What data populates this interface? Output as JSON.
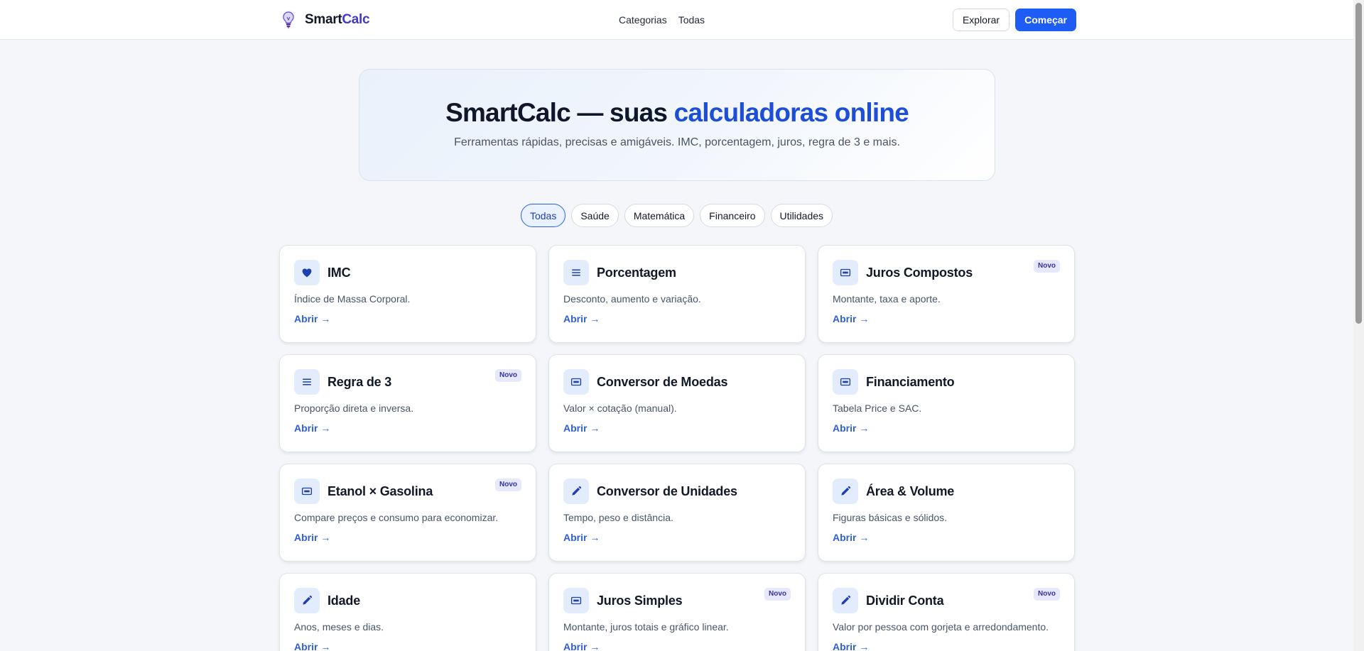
{
  "header": {
    "brand_prefix": "Smart",
    "brand_suffix": "Calc",
    "nav": [
      {
        "label": "Categorias"
      },
      {
        "label": "Todas"
      }
    ],
    "explore_label": "Explorar",
    "start_label": "Começar"
  },
  "hero": {
    "title_main": "SmartCalc — suas ",
    "title_accent": "calculadoras online",
    "subtitle": "Ferramentas rápidas, precisas e amigáveis. IMC, porcentagem, juros, regra de 3 e mais."
  },
  "filters": [
    {
      "label": "Todas",
      "active": true
    },
    {
      "label": "Saúde",
      "active": false
    },
    {
      "label": "Matemática",
      "active": false
    },
    {
      "label": "Financeiro",
      "active": false
    },
    {
      "label": "Utilidades",
      "active": false
    }
  ],
  "cards": [
    {
      "title": "IMC",
      "description": "Índice de Massa Corporal.",
      "icon": "heart-icon",
      "badge": "",
      "link": "Abrir →"
    },
    {
      "title": "Porcentagem",
      "description": "Desconto, aumento e variação.",
      "icon": "list-icon",
      "badge": "",
      "link": "Abrir →"
    },
    {
      "title": "Juros Compostos",
      "description": "Montante, taxa e aporte.",
      "icon": "banknote-icon",
      "badge": "Novo",
      "link": "Abrir →"
    },
    {
      "title": "Regra de 3",
      "description": "Proporção direta e inversa.",
      "icon": "list-icon",
      "badge": "Novo",
      "link": "Abrir →"
    },
    {
      "title": "Conversor de Moedas",
      "description": "Valor × cotação (manual).",
      "icon": "banknote-icon",
      "badge": "",
      "link": "Abrir →"
    },
    {
      "title": "Financiamento",
      "description": "Tabela Price e SAC.",
      "icon": "banknote-icon",
      "badge": "",
      "link": "Abrir →"
    },
    {
      "title": "Etanol × Gasolina",
      "description": "Compare preços e consumo para economizar.",
      "icon": "banknote-icon",
      "badge": "Novo",
      "link": "Abrir →"
    },
    {
      "title": "Conversor de Unidades",
      "description": "Tempo, peso e distância.",
      "icon": "pencil-icon",
      "badge": "",
      "link": "Abrir →"
    },
    {
      "title": "Área & Volume",
      "description": "Figuras básicas e sólidos.",
      "icon": "pencil-icon",
      "badge": "",
      "link": "Abrir →"
    },
    {
      "title": "Idade",
      "description": "Anos, meses e dias.",
      "icon": "pencil-icon",
      "badge": "",
      "link": "Abrir →"
    },
    {
      "title": "Juros Simples",
      "description": "Montante, juros totais e gráfico linear.",
      "icon": "banknote-icon",
      "badge": "Novo",
      "link": "Abrir →"
    },
    {
      "title": "Dividir Conta",
      "description": "Valor por pessoa com gorjeta e arredondamento.",
      "icon": "pencil-icon",
      "badge": "Novo",
      "link": "Abrir →"
    }
  ],
  "colors": {
    "primary": "#1d5cf5",
    "brand_accent": "#4338ca",
    "hero_accent": "#1d4ed8",
    "icon_color": "#1e40af",
    "icon_bg": "#e3ecfd",
    "badge_bg": "#e6e8fb"
  }
}
